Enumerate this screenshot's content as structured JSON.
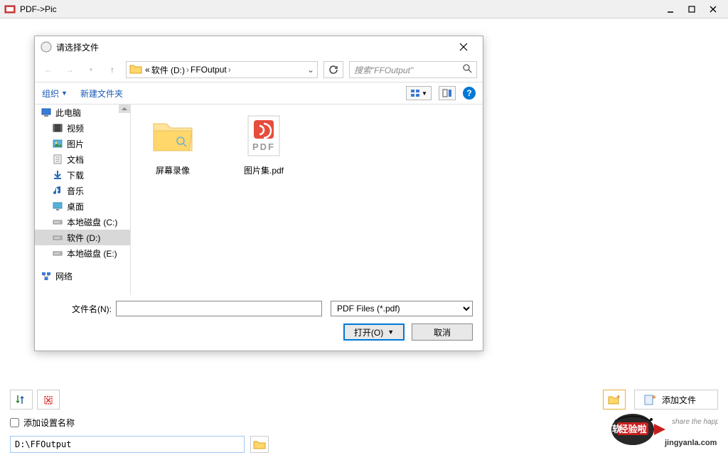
{
  "main_window": {
    "title": "PDF->Pic",
    "toolbar": {
      "add_file_label": "添加文件"
    },
    "checkbox_label": "添加设置名称",
    "output_path": "D:\\FFOutput"
  },
  "dialog": {
    "title": "请选择文件",
    "breadcrumb": {
      "prefix": "« ",
      "parts": [
        "软件 (D:)",
        "FFOutput"
      ]
    },
    "search_placeholder": "搜索\"FFOutput\"",
    "toolbar": {
      "organize": "组织",
      "new_folder": "新建文件夹"
    },
    "sidebar": [
      {
        "label": "此电脑",
        "icon": "pc",
        "indent": 0
      },
      {
        "label": "视频",
        "icon": "video",
        "indent": 1
      },
      {
        "label": "图片",
        "icon": "pictures",
        "indent": 1
      },
      {
        "label": "文档",
        "icon": "documents",
        "indent": 1
      },
      {
        "label": "下载",
        "icon": "downloads",
        "indent": 1
      },
      {
        "label": "音乐",
        "icon": "music",
        "indent": 1
      },
      {
        "label": "桌面",
        "icon": "desktop",
        "indent": 1
      },
      {
        "label": "本地磁盘 (C:)",
        "icon": "drive",
        "indent": 1
      },
      {
        "label": "软件 (D:)",
        "icon": "drive",
        "indent": 1,
        "selected": true
      },
      {
        "label": "本地磁盘 (E:)",
        "icon": "drive",
        "indent": 1
      },
      {
        "label": "网络",
        "icon": "network",
        "indent": 0
      }
    ],
    "items": [
      {
        "name": "屏幕录像",
        "type": "folder"
      },
      {
        "name": "图片集.pdf",
        "type": "pdf"
      }
    ],
    "filename_label": "文件名(N):",
    "filename_value": "",
    "filetype": "PDF Files (*.pdf)",
    "open_btn": "打开(O)",
    "cancel_btn": "取消"
  },
  "watermark": {
    "line1": "软件经验啦",
    "line2": "jingyanla.com"
  }
}
